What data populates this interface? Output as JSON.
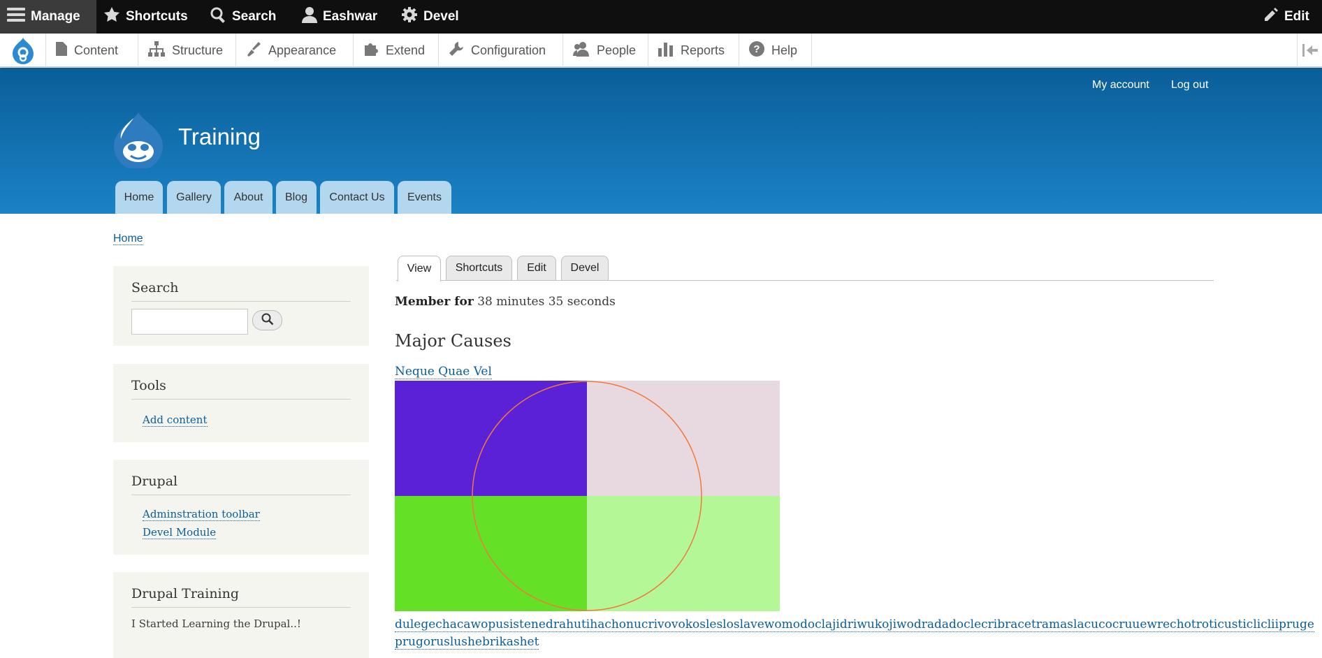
{
  "toolbar": {
    "manage": "Manage",
    "shortcuts": "Shortcuts",
    "search": "Search",
    "user": "Eashwar",
    "devel": "Devel",
    "edit": "Edit"
  },
  "tray": {
    "items": [
      "Content",
      "Structure",
      "Appearance",
      "Extend",
      "Configuration",
      "People",
      "Reports",
      "Help"
    ]
  },
  "header": {
    "my_account": "My account",
    "log_out": "Log out",
    "site_name": "Training",
    "nav": [
      "Home",
      "Gallery",
      "About",
      "Blog",
      "Contact Us",
      "Events"
    ]
  },
  "breadcrumb": "Home",
  "sidebar": {
    "search_title": "Search",
    "tools_title": "Tools",
    "tools_links": [
      "Add content"
    ],
    "drupal_title": "Drupal",
    "drupal_links": [
      "Adminstration toolbar",
      "Devel Module"
    ],
    "training_title": "Drupal Training",
    "training_text": "I Started Learning the Drupal..!"
  },
  "tabs": [
    "View",
    "Shortcuts",
    "Edit",
    "Devel"
  ],
  "main": {
    "member_label": "Member for",
    "member_value": "38 minutes 35 seconds",
    "section_title": "Major Causes",
    "item_title": "Neque Quae Vel",
    "long_link_1": "dulegechacawopusistenedrahutihachonucrivovokoslesloslavewomodoclajidriwukojiwodradadoclecribracetramaslacucocruuewrechotroticusticlicliipruge",
    "long_link_2": "prugoruslushebrikashet"
  },
  "colors": {
    "quad_top_left": "#5b21d6",
    "quad_top_right": "#e8d8df",
    "quad_bottom_left": "#64e027",
    "quad_bottom_right": "#b3f797",
    "circle": "#f07a3c"
  }
}
